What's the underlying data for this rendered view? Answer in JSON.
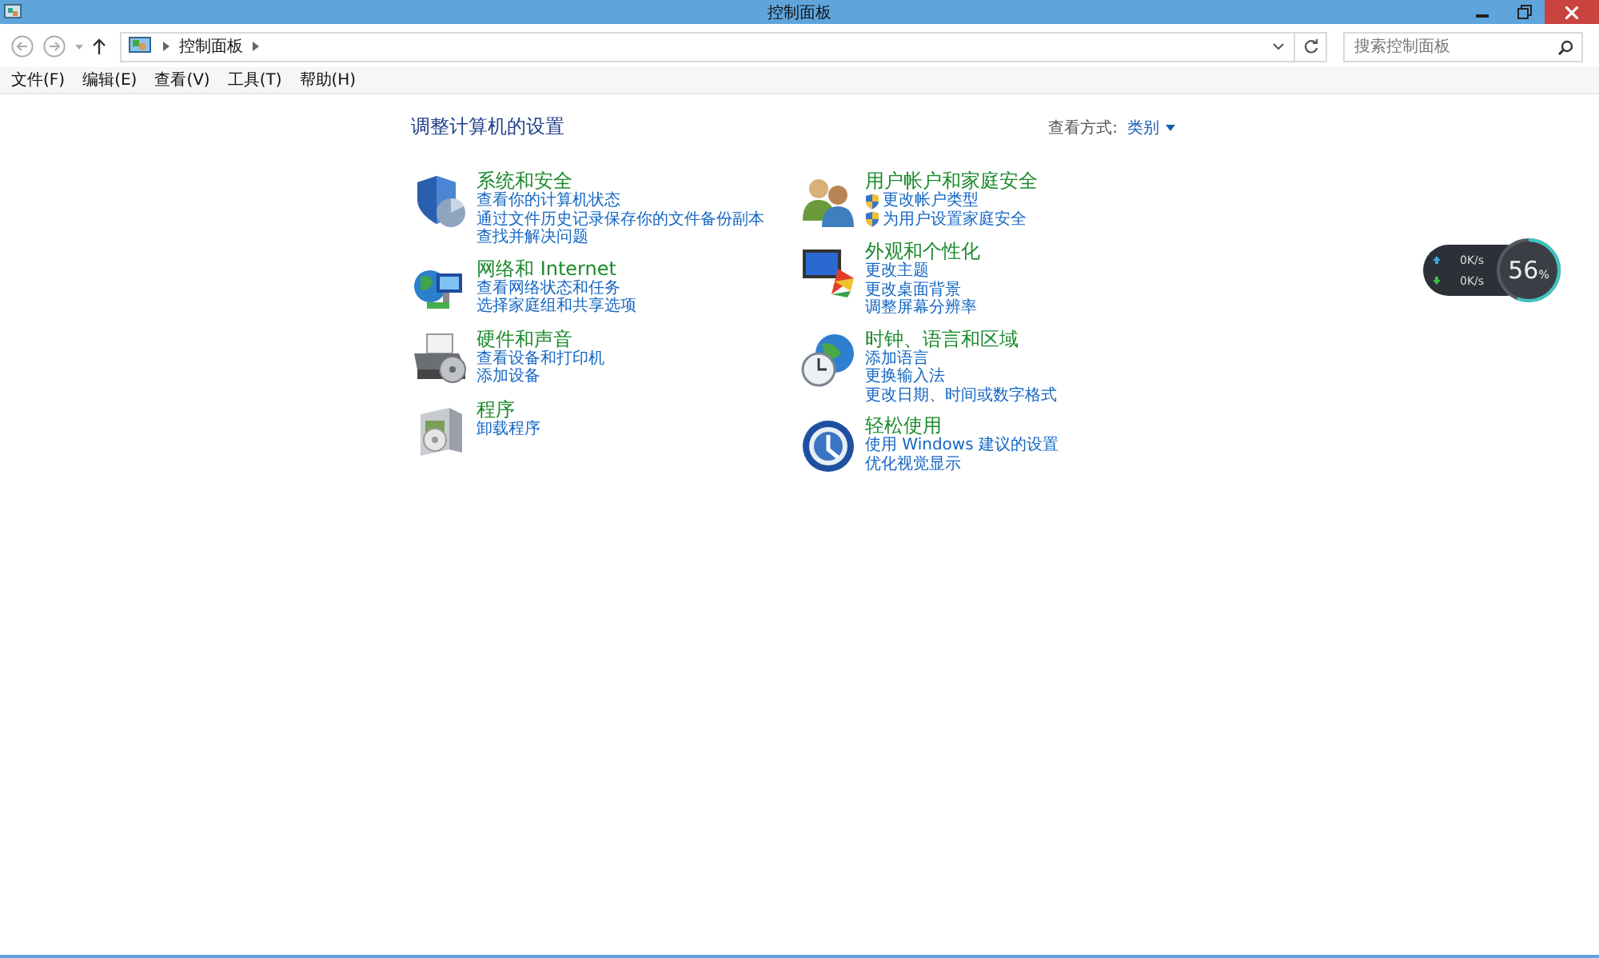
{
  "window": {
    "title": "控制面板"
  },
  "address_bar": {
    "path": [
      "控制面板"
    ],
    "search": {
      "placeholder": "搜索控制面板"
    }
  },
  "menu_bar": [
    "文件(F)",
    "编辑(E)",
    "查看(V)",
    "工具(T)",
    "帮助(H)"
  ],
  "heading": "调整计算机的设置",
  "view_by": {
    "label": "查看方式:",
    "value": "类别"
  },
  "columns": [
    [
      {
        "kind": "shield",
        "title": "系统和安全",
        "links": [
          {
            "text": "查看你的计算机状态",
            "kind": "plain"
          },
          {
            "text": "通过文件历史记录保存你的文件备份副本",
            "kind": "plain"
          },
          {
            "text": "查找并解决问题",
            "kind": "plain"
          }
        ]
      },
      {
        "kind": "network",
        "title": "网络和 Internet",
        "links": [
          {
            "text": "查看网络状态和任务",
            "kind": "plain"
          },
          {
            "text": "选择家庭组和共享选项",
            "kind": "plain"
          }
        ]
      },
      {
        "kind": "printer",
        "title": "硬件和声音",
        "links": [
          {
            "text": "查看设备和打印机",
            "kind": "plain"
          },
          {
            "text": "添加设备",
            "kind": "plain"
          }
        ]
      },
      {
        "kind": "programs",
        "title": "程序",
        "links": [
          {
            "text": "卸载程序",
            "kind": "plain"
          }
        ]
      }
    ],
    [
      {
        "kind": "users",
        "title": "用户帐户和家庭安全",
        "links": [
          {
            "text": "更改帐户类型",
            "kind": "shield"
          },
          {
            "text": "为用户设置家庭安全",
            "kind": "shield"
          }
        ]
      },
      {
        "kind": "display",
        "title": "外观和个性化",
        "links": [
          {
            "text": "更改主题",
            "kind": "plain"
          },
          {
            "text": "更改桌面背景",
            "kind": "plain"
          },
          {
            "text": "调整屏幕分辨率",
            "kind": "plain"
          }
        ]
      },
      {
        "kind": "clock",
        "title": "时钟、语言和区域",
        "links": [
          {
            "text": "添加语言",
            "kind": "plain"
          },
          {
            "text": "更换输入法",
            "kind": "plain"
          },
          {
            "text": "更改日期、时间或数字格式",
            "kind": "plain"
          }
        ]
      },
      {
        "kind": "access",
        "title": "轻松使用",
        "links": [
          {
            "text": "使用 Windows 建议的设置",
            "kind": "plain"
          },
          {
            "text": "优化视觉显示",
            "kind": "plain"
          }
        ]
      }
    ]
  ],
  "net_widget": {
    "upload": "0K/s",
    "download": "0K/s",
    "percent": "56",
    "unit": "%",
    "level": 0.56
  }
}
